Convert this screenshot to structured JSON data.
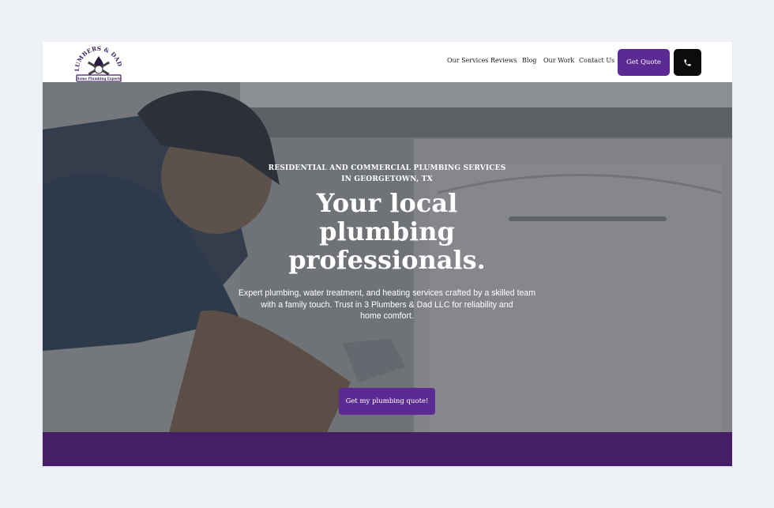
{
  "brand": {
    "name": "3 PLUMBERS & DAD LLC",
    "tagline": "Home Plumbing Experts",
    "accent": "#5b2a92",
    "band": "#461e66"
  },
  "nav": {
    "items": [
      "Our Services",
      "Reviews",
      "Blog",
      "Our Work",
      "Contact Us"
    ],
    "quote_label": "Get Quote",
    "phone_icon": "phone-icon"
  },
  "hero": {
    "eyebrow_line1": "RESIDENTIAL AND COMMERCIAL PLUMBING SERVICES",
    "eyebrow_line2": "IN GEORGETOWN, TX",
    "headline_line1": "Your local",
    "headline_line2": "plumbing",
    "headline_line3": "professionals.",
    "description_line1": "Expert plumbing, water treatment, and heating services crafted by a skilled team",
    "description_line2": "with a family touch. Trust in 3 Plumbers & Dad LLC for reliability and",
    "description_line3": "home comfort.",
    "cta_label": "Get my plumbing quote!"
  }
}
